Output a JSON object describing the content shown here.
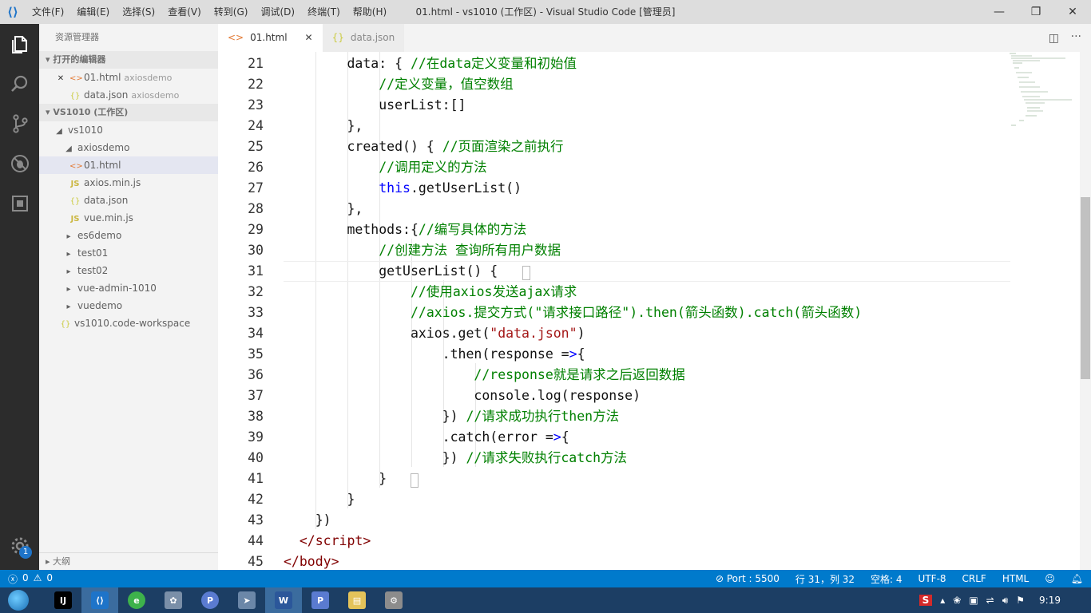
{
  "titlebar": {
    "menu": [
      "文件(F)",
      "编辑(E)",
      "选择(S)",
      "查看(V)",
      "转到(G)",
      "调试(D)",
      "终端(T)",
      "帮助(H)"
    ],
    "title": "01.html - vs1010 (工作区) - Visual Studio Code [管理员]"
  },
  "activity": {
    "badge": "1"
  },
  "sidebar": {
    "title": "资源管理器",
    "open_editors_header": "打开的编辑器",
    "open_editors": [
      {
        "name": "01.html",
        "desc": "axiosdemo"
      },
      {
        "name": "data.json",
        "desc": "axiosdemo"
      }
    ],
    "workspace_header": "VS1010 (工作区)",
    "tree": {
      "root": "vs1010",
      "axiosdemo": "axiosdemo",
      "files": [
        "01.html",
        "axios.min.js",
        "data.json",
        "vue.min.js"
      ],
      "folders": [
        "es6demo",
        "test01",
        "test02",
        "vue-admin-1010",
        "vuedemo"
      ],
      "workspace_file": "vs1010.code-workspace"
    },
    "outline": "大纲"
  },
  "tabs": [
    {
      "label": "01.html"
    },
    {
      "label": "data.json"
    }
  ],
  "editor": {
    "line_numbers": [
      "21",
      "22",
      "23",
      "24",
      "25",
      "26",
      "27",
      "28",
      "29",
      "30",
      "31",
      "32",
      "33",
      "34",
      "35",
      "36",
      "37",
      "38",
      "39",
      "40",
      "41",
      "42",
      "43",
      "44",
      "45"
    ]
  },
  "statusbar": {
    "errors": "0",
    "warnings": "0",
    "port": "Port : 5500",
    "position": "行 31，列 32",
    "spaces": "空格: 4",
    "encoding": "UTF-8",
    "eol": "CRLF",
    "language": "HTML"
  },
  "taskbar": {
    "time": "9:19"
  }
}
